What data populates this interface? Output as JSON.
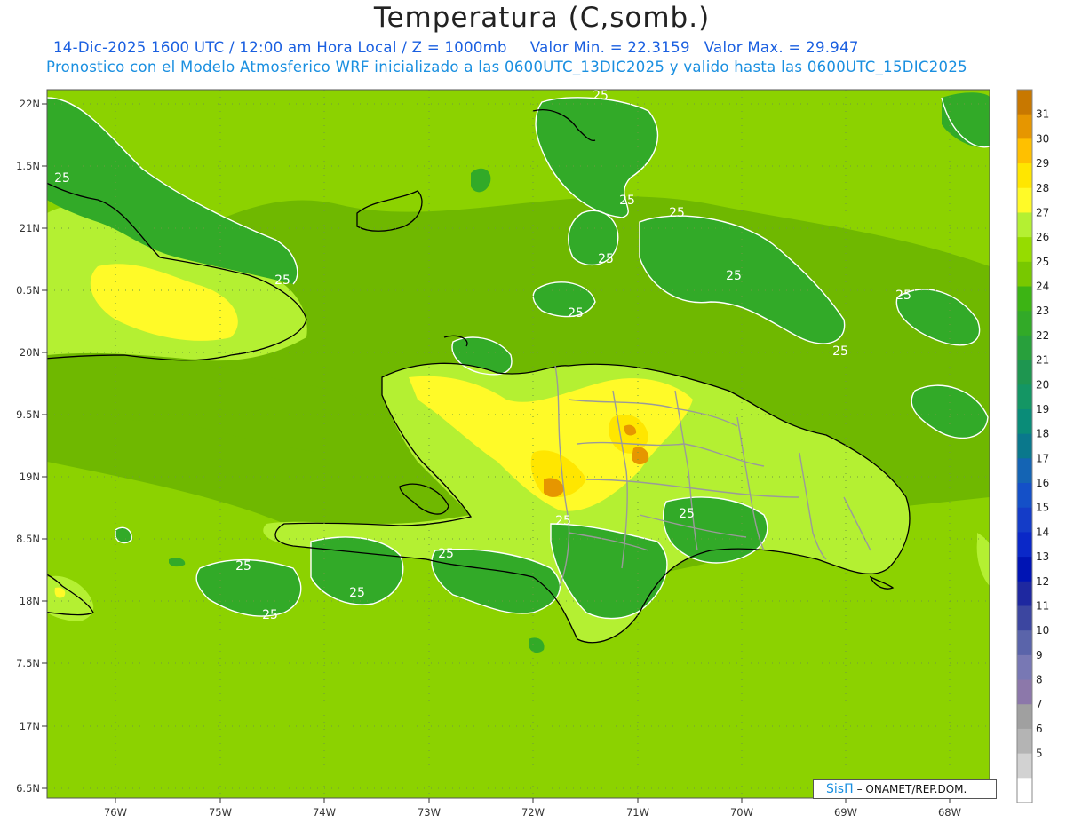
{
  "title": "Temperatura (C,somb.)",
  "subtitle_line1": "14-Dic-2025 1600 UTC / 12:00 am Hora Local / Z = 1000mb",
  "value_min": "Valor Min. = 22.3159",
  "value_max": "Valor Max. = 29.947",
  "subtitle_line2": "Pronostico con el Modelo Atmosferico WRF inicializado a las 0600UTC_13DIC2025 y valido hasta las  0600UTC_15DIC2025",
  "lat_labels": [
    "22N",
    "1.5N",
    "21N",
    "0.5N",
    "20N",
    "9.5N",
    "19N",
    "8.5N",
    "18N",
    "7.5N",
    "17N",
    "6.5N"
  ],
  "lon_labels": [
    "76W",
    "75W",
    "74W",
    "73W",
    "72W",
    "71W",
    "70W",
    "69W",
    "68W"
  ],
  "contour_labels": [
    "25",
    "25",
    "25",
    "25",
    "25",
    "25",
    "25",
    "25",
    "25",
    "25",
    "25",
    "25",
    "25",
    "25",
    "25",
    "25"
  ],
  "colorbar": {
    "labels": [
      "31",
      "30",
      "29",
      "28",
      "27",
      "26",
      "25",
      "24",
      "23",
      "22",
      "21",
      "20",
      "19",
      "18",
      "17",
      "16",
      "15",
      "14",
      "13",
      "12",
      "11",
      "10",
      "9",
      "8",
      "7",
      "6",
      "5"
    ],
    "colors": [
      "#c87800",
      "#e69600",
      "#ffc000",
      "#ffe600",
      "#fffa28",
      "#b4f032",
      "#96dc00",
      "#78c800",
      "#3cb414",
      "#32aa28",
      "#28a03c",
      "#1e9650",
      "#149664",
      "#0a8c78",
      "#0a788c",
      "#1464b4",
      "#1450c8",
      "#143cc8",
      "#0a28c8",
      "#0014b4",
      "#1e28a0",
      "#3c46a0",
      "#5a64aa",
      "#7878b4",
      "#8c78aa",
      "#a0a0a0",
      "#b4b4b4",
      "#d2d2d2",
      "#ffffff"
    ]
  },
  "colors": {
    "ocean": "#6fb800",
    "ocean_warm": "#8cd200",
    "land_warm": "#b4f032",
    "land_hot": "#fffa28",
    "land_hotter": "#ffe600",
    "land_hottest": "#e69600",
    "cool": "#32aa28",
    "coast": "#000000",
    "border": "#9a9a9a",
    "contour": "#ffffff"
  },
  "credit": {
    "logo": "SisΠ",
    "agency": "– ONAMET/REP.DOM."
  }
}
